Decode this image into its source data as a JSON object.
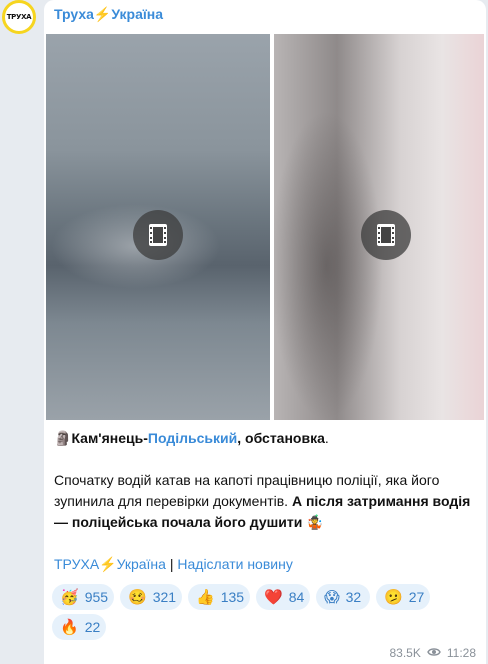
{
  "channel": {
    "avatar_text": "ТРУХА",
    "name": "Труха⚡Україна"
  },
  "media": [
    {
      "label": "video-1"
    },
    {
      "label": "video-2"
    }
  ],
  "post": {
    "line1_emoji": "🗿",
    "line1_city_a": "Кам'янець-",
    "line1_city_link": "Подільський",
    "line1_rest": ", обстановка",
    "line1_dot": ".",
    "line2_plain": "Спочатку водій катав на капоті працівницю поліції, яка його зупинила для перевірки документів. ",
    "line2_bold": "А після затримання водія — поліцейська почала його душити",
    "line2_emoji": "🤹",
    "footer_link1": "ТРУХА⚡Україна",
    "footer_sep": " | ",
    "footer_link2": "Надіслати новину"
  },
  "reactions": [
    {
      "emoji": "🥳",
      "count": "955"
    },
    {
      "emoji": "🥴",
      "count": "321"
    },
    {
      "emoji": "👍",
      "count": "135"
    },
    {
      "emoji": "❤️",
      "count": "84"
    },
    {
      "emoji": "😱",
      "count": "32"
    },
    {
      "emoji": "🫤",
      "count": "27"
    },
    {
      "emoji": "🔥",
      "count": "22"
    }
  ],
  "meta": {
    "views": "83.5K",
    "time": "11:28"
  }
}
